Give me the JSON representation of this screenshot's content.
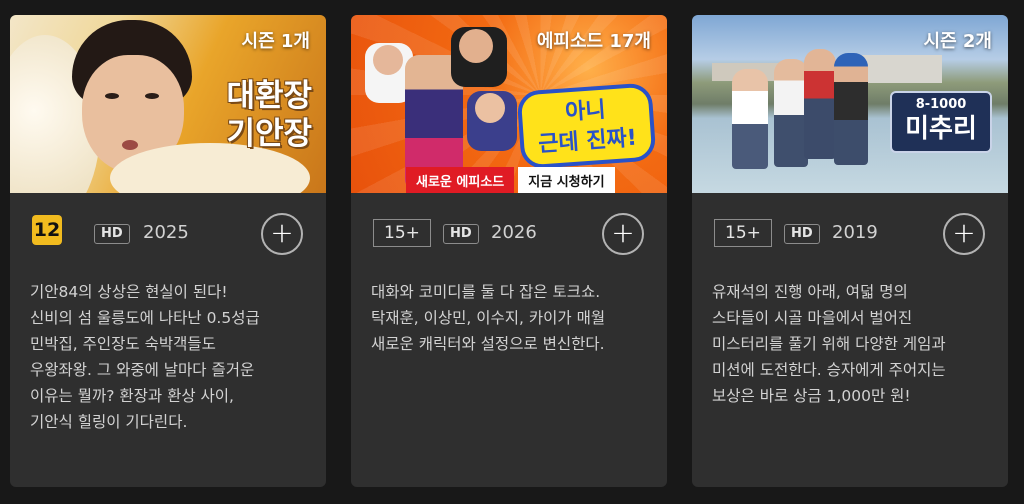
{
  "cards": [
    {
      "season": "시즌 1개",
      "thumb_title_line1": "대환장",
      "thumb_title_line2": "기안장",
      "rating": "12",
      "quality": "HD",
      "year": "2025",
      "add_icon": "plus-icon",
      "add_symbol": "+",
      "description": "기안84의 상상은 현실이 된다!\n신비의 섬 울릉도에 나타난 0.5성급\n민박집, 주인장도 숙박객들도\n우왕좌왕. 그 와중에 날마다 즐거운\n이유는 뭘까? 환장과 환상 사이,\n기안식 힐링이 기다린다."
    },
    {
      "season": "에피소드 17개",
      "thumb_title_line1": "아니",
      "thumb_title_line2": "근데 진짜!",
      "thumb_badge_new": "새로운 에피소드",
      "thumb_badge_watch": "지금 시청하기",
      "rating": "15+",
      "quality": "HD",
      "year": "2026",
      "add_icon": "plus-icon",
      "add_symbol": "+",
      "description": "대화와 코미디를 둘 다 잡은 토크쇼.\n탁재훈, 이상민, 이수지, 카이가 매월\n새로운 캐릭터와 설정으로 변신한다."
    },
    {
      "season": "시즌 2개",
      "thumb_title_line1": "8-1000",
      "thumb_title_line2": "미추리",
      "rating": "15+",
      "quality": "HD",
      "year": "2019",
      "add_icon": "plus-icon",
      "add_symbol": "+",
      "description": "유재석의 진행 아래, 여덟 명의\n스타들이 시골 마을에서 벌어진\n미스터리를 풀기 위해 다양한 게임과\n미션에 도전한다. 승자에게 주어지는\n보상은 바로 상금 1,000만 원!"
    }
  ]
}
